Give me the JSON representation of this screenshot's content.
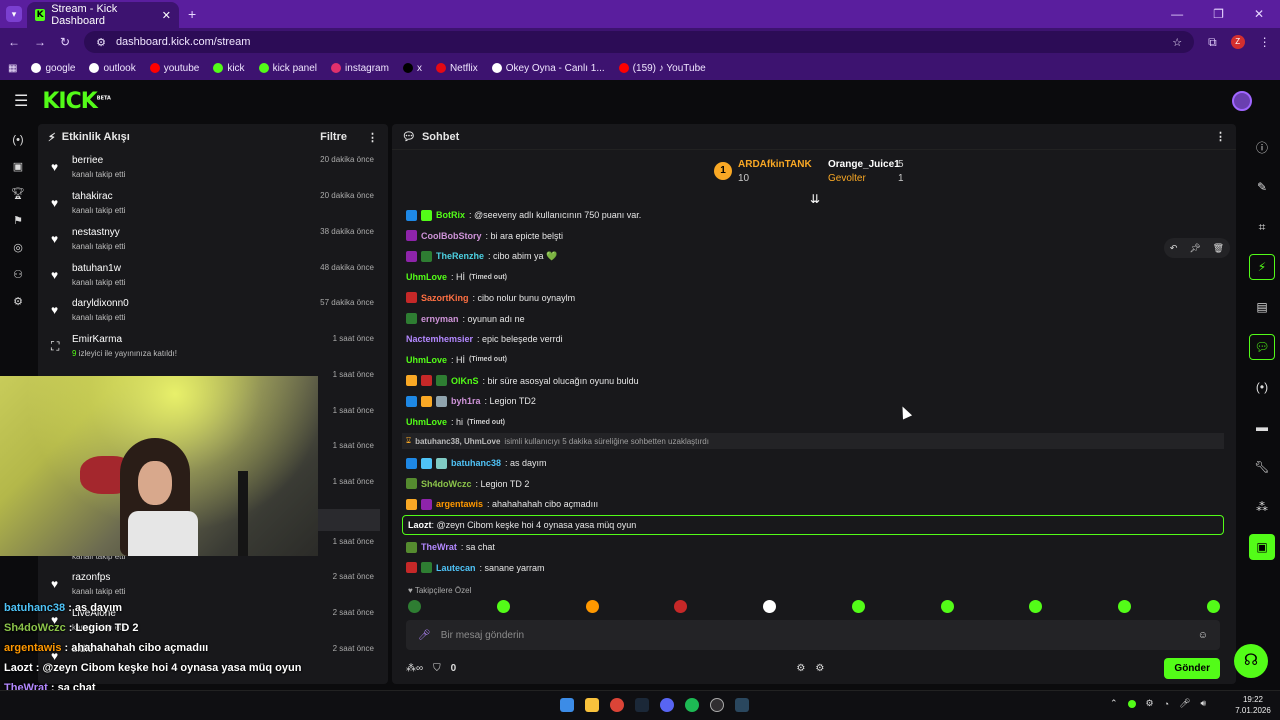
{
  "browser": {
    "tab_title": "Stream - Kick Dashboard",
    "url": "dashboard.kick.com/stream",
    "profile_initial": "Z",
    "bookmarks": [
      {
        "label": "google",
        "color": "#ffffff"
      },
      {
        "label": "outlook",
        "color": "#ffffff"
      },
      {
        "label": "youtube",
        "color": "#ff0000"
      },
      {
        "label": "kick",
        "color": "#53fc18"
      },
      {
        "label": "kick panel",
        "color": "#53fc18"
      },
      {
        "label": "instagram",
        "color": "#e1306c"
      },
      {
        "label": "x",
        "color": "#000000"
      },
      {
        "label": "Netflix",
        "color": "#e50914"
      },
      {
        "label": "Okey Oyna - Canlı 1...",
        "color": "#ffffff"
      },
      {
        "label": "(159) ♪ YouTube",
        "color": "#ff0000"
      }
    ]
  },
  "site": {
    "logo": "KICK",
    "logo_badge": "BETA"
  },
  "activity": {
    "title": "Etkinlik Akışı",
    "filter_label": "Filtre",
    "items": [
      {
        "name": "berriee",
        "sub": "kanalı takip etti",
        "time": "20 dakika önce",
        "icon": "heart-icon"
      },
      {
        "name": "tahakirac",
        "sub": "kanalı takip etti",
        "time": "20 dakika önce",
        "icon": "heart-icon"
      },
      {
        "name": "nestastnyy",
        "sub": "kanalı takip etti",
        "time": "38 dakika önce",
        "icon": "heart-icon"
      },
      {
        "name": "batuhan1w",
        "sub": "kanalı takip etti",
        "time": "48 dakika önce",
        "icon": "heart-icon"
      },
      {
        "name": "daryldixonn0",
        "sub": "kanalı takip etti",
        "time": "57 dakika önce",
        "icon": "heart-icon"
      },
      {
        "name": "EmirKarma",
        "sub_count": "9",
        "sub": "izleyici ile yayınınıza katıldı!",
        "time": "1 saat önce",
        "icon": "raid-icon"
      },
      {
        "name": "",
        "sub": "",
        "time": "1 saat önce",
        "icon": "heart-icon"
      },
      {
        "name": "",
        "sub": "",
        "time": "1 saat önce",
        "icon": "heart-icon"
      },
      {
        "name": "",
        "sub": "",
        "time": "1 saat önce",
        "icon": "heart-icon"
      },
      {
        "name": "",
        "sub": "",
        "time": "1 saat önce",
        "icon": "heart-icon"
      },
      {
        "name": "",
        "sub": "kanalı takip etti",
        "time": "1 saat önce",
        "icon": "heart-icon"
      },
      {
        "name": "razonfps",
        "sub": "kanalı takip etti",
        "time": "2 saat önce",
        "icon": "heart-icon"
      },
      {
        "name": "LiveAlone",
        "sub": "kanalı takip etti",
        "time": "2 saat önce",
        "icon": "heart-icon"
      },
      {
        "name": "bidi3",
        "sub": "",
        "time": "2 saat önce",
        "icon": "heart-icon"
      }
    ]
  },
  "overlay_chat": [
    {
      "user": "batuhanc38",
      "text": " : as dayım",
      "color": "#4fc3f7"
    },
    {
      "user": "Sh4doWczc",
      "text": " : Legion TD 2",
      "color": "#8bc34a"
    },
    {
      "user": "argentawis",
      "text": " : ahahahahah cibo açmadııı",
      "color": "#ff9800"
    },
    {
      "user": "Laozt",
      "text": " : @zeyn Cibom keşke hoi 4 oynasa yasa müq oyun",
      "color": "#ffffff"
    },
    {
      "user": "TheWrat",
      "text": " : sa chat",
      "color": "#b388ff"
    },
    {
      "user": "Lautecan",
      "text": " : sanane yarram",
      "color": "#64b5f6"
    }
  ],
  "chat": {
    "title": "Sohbet",
    "leaderboard": {
      "first_name": "ARDAfkinTANK",
      "first_rank": "1",
      "first_value": "10",
      "second_name": "Orange_Juice1",
      "second_value": "5",
      "third_name": "Gevolter",
      "third_value": "1"
    },
    "messages": [
      {
        "user": "BotRix",
        "color": "#53fc18",
        "text": ": @seeveny adlı kullanıcının 750 puanı var.",
        "badges": [
          "#1e88e5",
          "#53fc18"
        ]
      },
      {
        "user": "CoolBobStory",
        "color": "#ce93d8",
        "text": ": bi ara epicte belşti",
        "badges": [
          "#8e24aa"
        ]
      },
      {
        "user": "TheRenzhe",
        "color": "#4dd0e1",
        "text": ": cibo abim ya 💚",
        "badges": [
          "#8e24aa",
          "#2e7d32"
        ]
      },
      {
        "user": "UhmLove",
        "color": "#53fc18",
        "text": ": Hİ",
        "timed": "(Timed out)",
        "badges": []
      },
      {
        "user": "SazortKing",
        "color": "#ff7043",
        "text": ": cibo nolur bunu oynaylm",
        "badges": [
          "#c62828"
        ]
      },
      {
        "user": "ernyman",
        "color": "#ce93d8",
        "text": ": oyunun adı ne",
        "badges": [
          "#2e7d32"
        ]
      },
      {
        "user": "Nactemhemsier",
        "color": "#b388ff",
        "text": ": epic beleşede verrdi",
        "badges": []
      },
      {
        "user": "UhmLove",
        "color": "#53fc18",
        "text": ": Hİ",
        "timed": "(Timed out)",
        "badges": []
      },
      {
        "user": "OlKnS",
        "color": "#53fc18",
        "text": ": bir süre asosyal olucağın oyunu buldu",
        "badges": [
          "#f9a825",
          "#c62828",
          "#2e7d32"
        ]
      },
      {
        "user": "byh1ra",
        "color": "#ce93d8",
        "text": ": Legion TD2",
        "badges": [
          "#1e88e5",
          "#f9a825",
          "#90a4ae"
        ]
      },
      {
        "user": "UhmLove",
        "color": "#53fc18",
        "text": ": hi",
        "timed": "(Timed out)",
        "badges": []
      }
    ],
    "system_message": {
      "users": "batuhanc38, UhmLove",
      "text": "isimli kullanıcıyı 5 dakika süreliğine sohbetten uzaklaştırdı"
    },
    "messages_after": [
      {
        "user": "batuhanc38",
        "color": "#4fc3f7",
        "text": ": as dayım",
        "badges": [
          "#1e88e5",
          "#4fc3f7",
          "#80cbc4"
        ]
      },
      {
        "user": "Sh4doWczc",
        "color": "#8bc34a",
        "text": ": Legion TD 2",
        "badges": [
          "#558b2f"
        ]
      },
      {
        "user": "argentawis",
        "color": "#ff9800",
        "text": ": ahahahahah cibo açmadııı",
        "badges": [
          "#f9a825",
          "#8e24aa"
        ]
      }
    ],
    "highlighted": {
      "user": "Laozt",
      "text": ": @zeyn Cibom keşke hoi 4 oynasa yasa müq oyun"
    },
    "messages_end": [
      {
        "user": "TheWrat",
        "color": "#b388ff",
        "text": ": sa chat",
        "badges": [
          "#558b2f"
        ]
      },
      {
        "user": "Lautecan",
        "color": "#4fc3f7",
        "text": ": sanane yarram",
        "badges": [
          "#c62828",
          "#2e7d32"
        ]
      }
    ],
    "followers_only": "Takipçilere Özel",
    "input_placeholder": "Bir mesaj gönderin",
    "points_value": "0",
    "send_label": "Gönder"
  },
  "taskbar": {
    "time": "19:22",
    "date": "7.01.2026"
  }
}
